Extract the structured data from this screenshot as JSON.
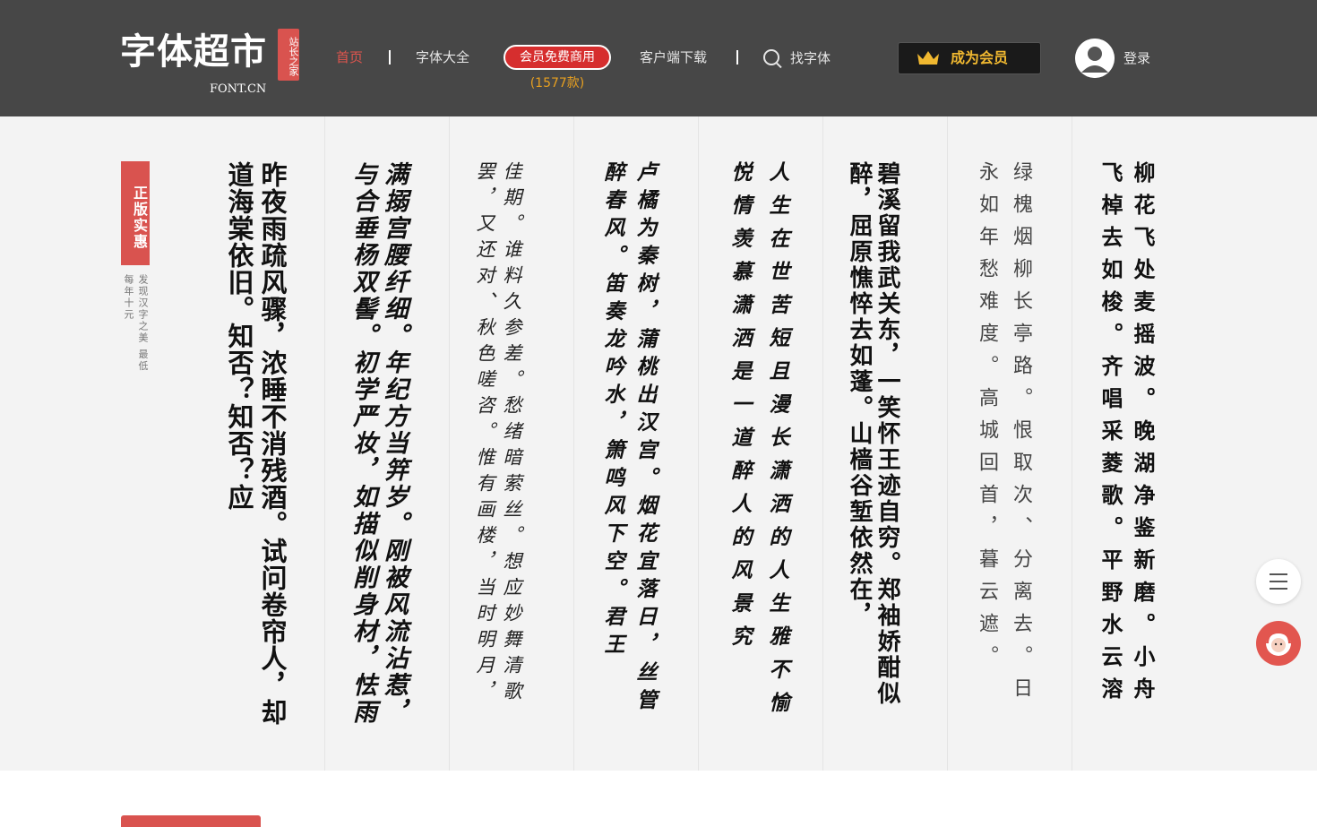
{
  "header": {
    "logo": {
      "main": "字体超市",
      "seal": "站长之家",
      "sub": "FONT.CN"
    },
    "nav": {
      "home": "首页",
      "fonts": "字体大全",
      "member": "会员免费商用",
      "member_count": "(1577款)",
      "client": "客户端下载",
      "search": "找字体"
    },
    "vip_button": "成为会员",
    "login": "登录"
  },
  "promo": {
    "badge": "正版实惠",
    "desc": "发现汉字之美 最低每年十元"
  },
  "columns": [
    {
      "text": "昨夜雨疏风骤，浓睡不消残酒。试问卷帘人，却道海棠依旧。知否？知否？应",
      "name": ""
    },
    {
      "text": "满搦宫腰纤细。年纪方当笄岁。刚被风流沾惹，与合垂杨双髻。初学严妆，如描似削身材，怯雨",
      "name": ""
    },
    {
      "text": "佳期。谁料久参差。愁绪暗萦丝。想应妙舞清歌罢，又还对、秋色嗟咨。惟有画楼，当时明月，",
      "name": ""
    },
    {
      "text": "卢橘为秦树，蒲桃出汉宫。烟花宜落日，丝管醉春风。笛奏龙吟水，箫鸣风下空。君王",
      "name": ""
    },
    {
      "text": "人生在世苦短且漫长潇洒的人生雅不愉悦情羡慕潇洒是一道醉人的风景究",
      "name": ""
    },
    {
      "text": "碧溪留我武关东，一笑怀王迹自穷。郑袖娇酣似醉，屈原憔悴去如蓬。山樯谷堑依然在，",
      "name": ""
    },
    {
      "text": "绿槐烟柳长亭路。恨取次、分离去。日永如年愁难度。高城回首，暮云遮。",
      "name": ""
    },
    {
      "text": "柳花飞处麦摇波。晚湖净鉴新磨。小舟飞棹去如梭。齐唱采菱歌。平野水云溶",
      "name": ""
    }
  ]
}
